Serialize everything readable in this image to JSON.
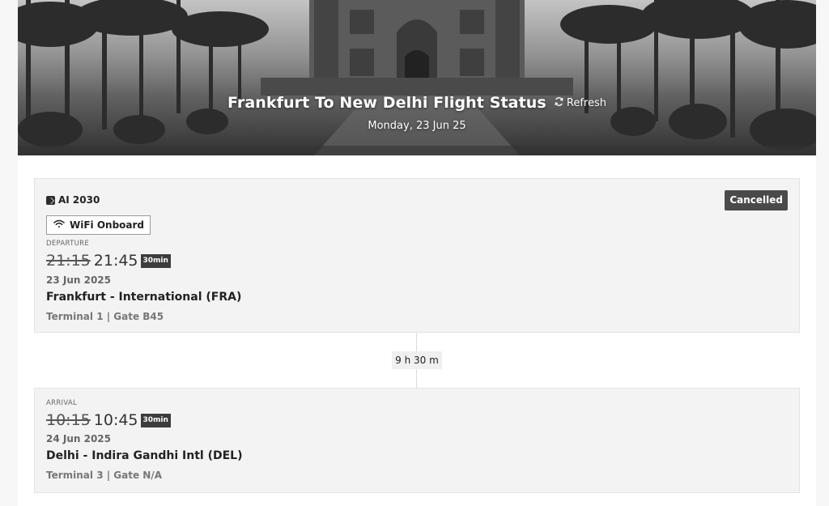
{
  "hero": {
    "title": "Frankfurt To New Delhi Flight Status",
    "refresh_label": "Refresh",
    "date": "Monday, 23 Jun 25"
  },
  "flight": {
    "number": "AI 2030",
    "status": "Cancelled",
    "amenity": "WiFi Onboard"
  },
  "departure": {
    "label": "DEPARTURE",
    "scheduled_time": "21:15",
    "actual_time": "21:45",
    "delay": "30min",
    "date": "23 Jun 2025",
    "airport": "Frankfurt - International (FRA)",
    "terminal_gate": "Terminal 1 | Gate B45"
  },
  "duration": "9 h 30 m",
  "arrival": {
    "label": "ARRIVAL",
    "scheduled_time": "10:15",
    "actual_time": "10:45",
    "delay": "30min",
    "date": "24 Jun 2025",
    "airport": "Delhi - Indira Gandhi Intl (DEL)",
    "terminal_gate": "Terminal 3 | Gate N/A"
  },
  "icons": {
    "refresh": "refresh-icon",
    "wifi": "wifi-icon",
    "airline": "airline-logo-icon"
  },
  "colors": {
    "status_badge": "#4a4a4a",
    "delay_badge": "#3c3c3c",
    "card_bg": "#f3f3f3"
  }
}
